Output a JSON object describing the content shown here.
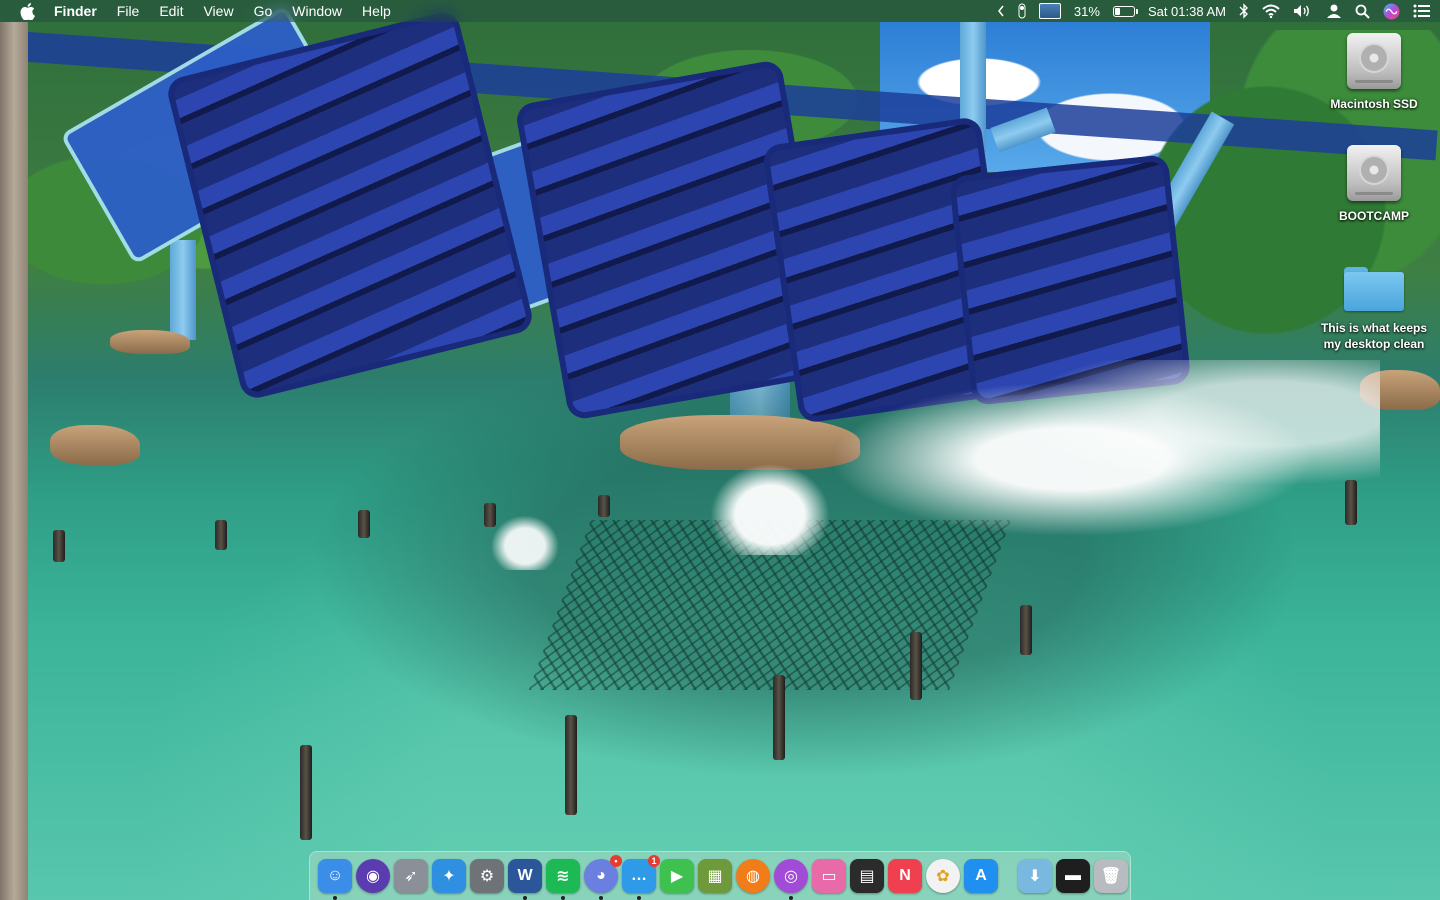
{
  "menubar": {
    "app_name": "Finder",
    "menus": [
      "File",
      "Edit",
      "View",
      "Go",
      "Window",
      "Help"
    ],
    "status": {
      "battery_percent": "31%",
      "battery_level": 0.31,
      "clock": "Sat 01:38 AM"
    }
  },
  "desktop": {
    "icons": [
      {
        "label": "Macintosh SSD",
        "kind": "hard-drive-icon"
      },
      {
        "label": "BOOTCAMP",
        "kind": "hard-drive-icon"
      },
      {
        "label": "This is what keeps my desktop clean",
        "kind": "folder-icon"
      }
    ]
  },
  "dock": {
    "apps": [
      {
        "name": "finder-icon",
        "color": "#3b8ee8",
        "glyph": "☺",
        "running": true
      },
      {
        "name": "siri-icon",
        "color": "#5b3bb0",
        "glyph": "◉",
        "running": false
      },
      {
        "name": "launchpad-icon",
        "color": "#8a8f98",
        "glyph": "➶",
        "running": false
      },
      {
        "name": "safari-icon",
        "color": "#2f8fe0",
        "glyph": "✦",
        "running": false
      },
      {
        "name": "system-preferences-icon",
        "color": "#6e7378",
        "glyph": "⚙",
        "running": false
      },
      {
        "name": "word-icon",
        "color": "#2b579a",
        "glyph": "W",
        "running": true
      },
      {
        "name": "spotify-icon",
        "color": "#1db954",
        "glyph": "≋",
        "running": true
      },
      {
        "name": "discord-icon",
        "color": "#6b7fe0",
        "glyph": "◕",
        "running": true,
        "badge": "•"
      },
      {
        "name": "messages-icon",
        "color": "#2f9be8",
        "glyph": "…",
        "running": true,
        "badge": "1"
      },
      {
        "name": "facetime-icon",
        "color": "#3fc14f",
        "glyph": "▶",
        "running": false
      },
      {
        "name": "minecraft-icon",
        "color": "#6e9a3c",
        "glyph": "▦",
        "running": false
      },
      {
        "name": "firefox-icon",
        "color": "#f07d1a",
        "glyph": "◍",
        "running": false
      },
      {
        "name": "podcasts-icon",
        "color": "#a24bd8",
        "glyph": "◎",
        "running": true
      },
      {
        "name": "notes-folder-icon",
        "color": "#e86aa8",
        "glyph": "▭",
        "running": false
      },
      {
        "name": "activity-monitor-icon",
        "color": "#2b2b2b",
        "glyph": "▤",
        "running": false
      },
      {
        "name": "news-icon",
        "color": "#f04050",
        "glyph": "N",
        "running": false
      },
      {
        "name": "photos-icon",
        "color": "#f2f2f2",
        "glyph": "✿",
        "running": false
      },
      {
        "name": "app-store-icon",
        "color": "#1f8ff0",
        "glyph": "A",
        "running": false
      }
    ],
    "stacks": [
      {
        "name": "downloads-folder-icon",
        "color": "#79b9e0",
        "glyph": "⬇"
      },
      {
        "name": "screenshot-stack-icon",
        "color": "#1e1e1e",
        "glyph": "▬"
      },
      {
        "name": "trash-icon",
        "color": "#b8bcc0",
        "glyph": "🗑"
      }
    ]
  }
}
